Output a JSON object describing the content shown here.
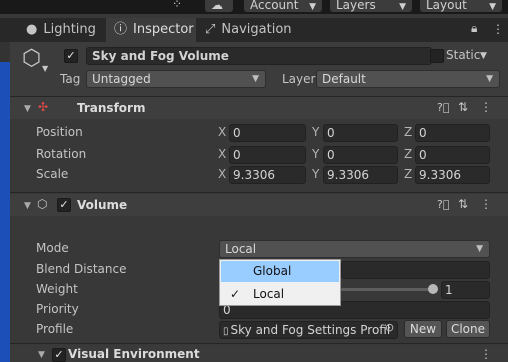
{
  "toolbar": {
    "account_label": "Account",
    "layers_label": "Layers",
    "layout_label": "Layout"
  },
  "tabs": [
    {
      "label": "Lighting",
      "icon": "lightbulb-icon"
    },
    {
      "label": "Inspector",
      "icon": "info-icon"
    },
    {
      "label": "Navigation",
      "icon": "navigation-icon"
    }
  ],
  "object": {
    "active": true,
    "name": "Sky and Fog Volume",
    "static_label": "Static",
    "tag_label": "Tag",
    "tag_value": "Untagged",
    "layer_label": "Layer",
    "layer_value": "Default"
  },
  "transform": {
    "title": "Transform",
    "rows": [
      {
        "label": "Position",
        "x": "0",
        "y": "0",
        "z": "0"
      },
      {
        "label": "Rotation",
        "x": "0",
        "y": "0",
        "z": "0"
      },
      {
        "label": "Scale",
        "x": "9.3306",
        "y": "9.3306",
        "z": "9.3306"
      }
    ],
    "axis_x": "X",
    "axis_y": "Y",
    "axis_z": "Z"
  },
  "volume": {
    "title": "Volume",
    "enabled": true,
    "mode_label": "Mode",
    "mode_value": "Local",
    "blend_distance_label": "Blend Distance",
    "weight_label": "Weight",
    "weight_value": "1",
    "weight_fraction": 1.0,
    "priority_label": "Priority",
    "priority_value": "0",
    "profile_label": "Profile",
    "profile_value": "Sky and Fog Settings Profil",
    "new_label": "New",
    "clone_label": "Clone"
  },
  "mode_popup": {
    "options": [
      {
        "label": "Global",
        "highlighted": true,
        "checked": false
      },
      {
        "label": "Local",
        "highlighted": false,
        "checked": true
      }
    ]
  },
  "visual_environment": {
    "title": "Visual Environment",
    "enabled": true
  },
  "colors": {
    "accent_highlight": "#99ccff",
    "panel_bg": "#383838"
  }
}
